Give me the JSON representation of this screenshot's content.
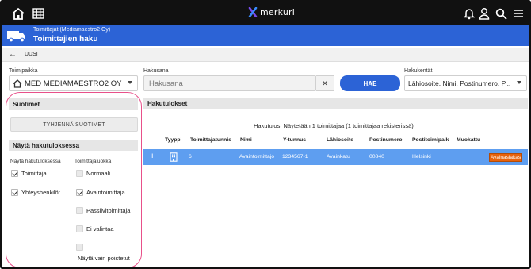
{
  "brand": {
    "name": "merkuri",
    "accent": "#2c63d6",
    "logo_color": "#7a4cf0"
  },
  "topbar": {
    "left_icons": [
      "home-icon",
      "grid-icon"
    ],
    "right_icons": [
      "bell-icon",
      "user-icon",
      "search-icon",
      "menu-icon"
    ]
  },
  "header": {
    "subtitle": "Toimittajat (Mediamaestro2 Oy)",
    "title": "Toimittajien haku"
  },
  "breadcrumb": {
    "label": "UUSI"
  },
  "search": {
    "company_label": "Toimipaikka",
    "company_value": "MED MEDIAMAESTRO2 OY",
    "keyword_label": "Hakusana",
    "keyword_placeholder": "Hakusana",
    "clear_symbol": "✕",
    "search_button": "HAE",
    "fields_label": "Hakukentät",
    "fields_value": "Lähiosoite, Nimi, Postinumero, P..."
  },
  "filters": {
    "title": "Suotimet",
    "clear_button": "TYHJENNÄ SUOTIMET",
    "show_title": "Näytä hakutuloksessa",
    "col1_label": "Näytä hakutuloksessa",
    "col2_label": "Toimittajaluokka",
    "col1": [
      {
        "label": "Toimittaja",
        "checked": true
      },
      {
        "label": "Yhteyshenkilöt",
        "checked": true
      }
    ],
    "col2": [
      {
        "label": "Normaali",
        "checked": false
      },
      {
        "label": "Avaintoimittaja",
        "checked": true
      },
      {
        "label": "Passiivitoimittaja",
        "checked": false
      },
      {
        "label": "Ei valintaa",
        "checked": false
      },
      {
        "label": "Näytä vain poistetut",
        "checked": false
      }
    ]
  },
  "results": {
    "title": "Hakutulokset",
    "summary": "Hakutulos: Näytetään 1 toimittajaa (1 toimittajaa rekisterissä)",
    "columns": [
      "Tyyppi",
      "Toimittajatunnis",
      "Nimi",
      "Y-tunnus",
      "Lähiosoite",
      "Postinumero",
      "Postitoimipaik",
      "Muokattu"
    ],
    "rows": [
      {
        "expand": "+",
        "type_icon": "building-icon",
        "id": "6",
        "name": "Avaintoimittajo",
        "business_id": "1234567-1",
        "street": "Avainkatu",
        "postcode": "00840",
        "city": "Helsinki",
        "modified": "",
        "tag": "Avainasiakas"
      }
    ]
  }
}
